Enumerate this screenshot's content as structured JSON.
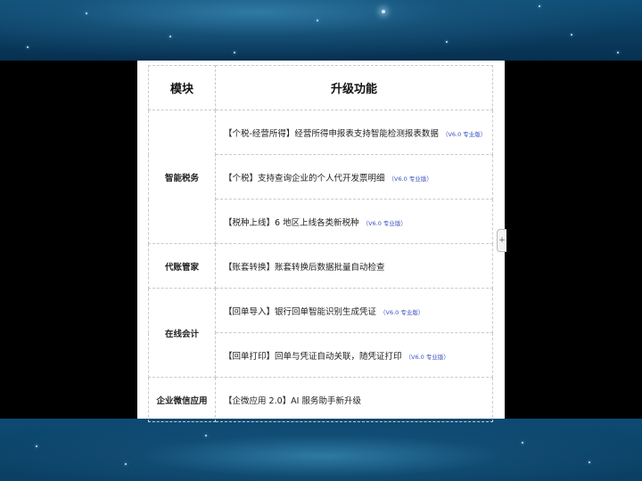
{
  "table": {
    "header": {
      "module": "模块",
      "feature": "升级功能"
    },
    "rows": [
      {
        "module": "智能税务",
        "rowspan": 3,
        "feature": "【个税-经营所得】经营所得申报表支持智能检测报表数据",
        "version": "（V6.0 专业版）"
      },
      {
        "feature": "【个税】支持查询企业的个人代开发票明细",
        "version": "（V6.0 专业版）"
      },
      {
        "feature": "【税种上线】6 地区上线各类新税种",
        "version": "（V6.0 专业版）"
      },
      {
        "module": "代账管家",
        "rowspan": 1,
        "feature": "【账套转换】账套转换后数据批量自动检查",
        "version": ""
      },
      {
        "module": "在线会计",
        "rowspan": 2,
        "feature": "【回单导入】银行回单智能识别生成凭证",
        "version": "（V6.0 专业版）"
      },
      {
        "feature": "【回单打印】回单与凭证自动关联，随凭证打印",
        "version": "（V6.0 专业版）"
      },
      {
        "module": "企业微信应用",
        "rowspan": 1,
        "feature": "【企微应用 2.0】AI 服务助手新升级",
        "version": ""
      }
    ]
  },
  "side_widget": {
    "icon": "plus-icon",
    "glyph": "+"
  },
  "colors": {
    "version_text": "#3a4fc2",
    "background": "#0b3f63"
  }
}
